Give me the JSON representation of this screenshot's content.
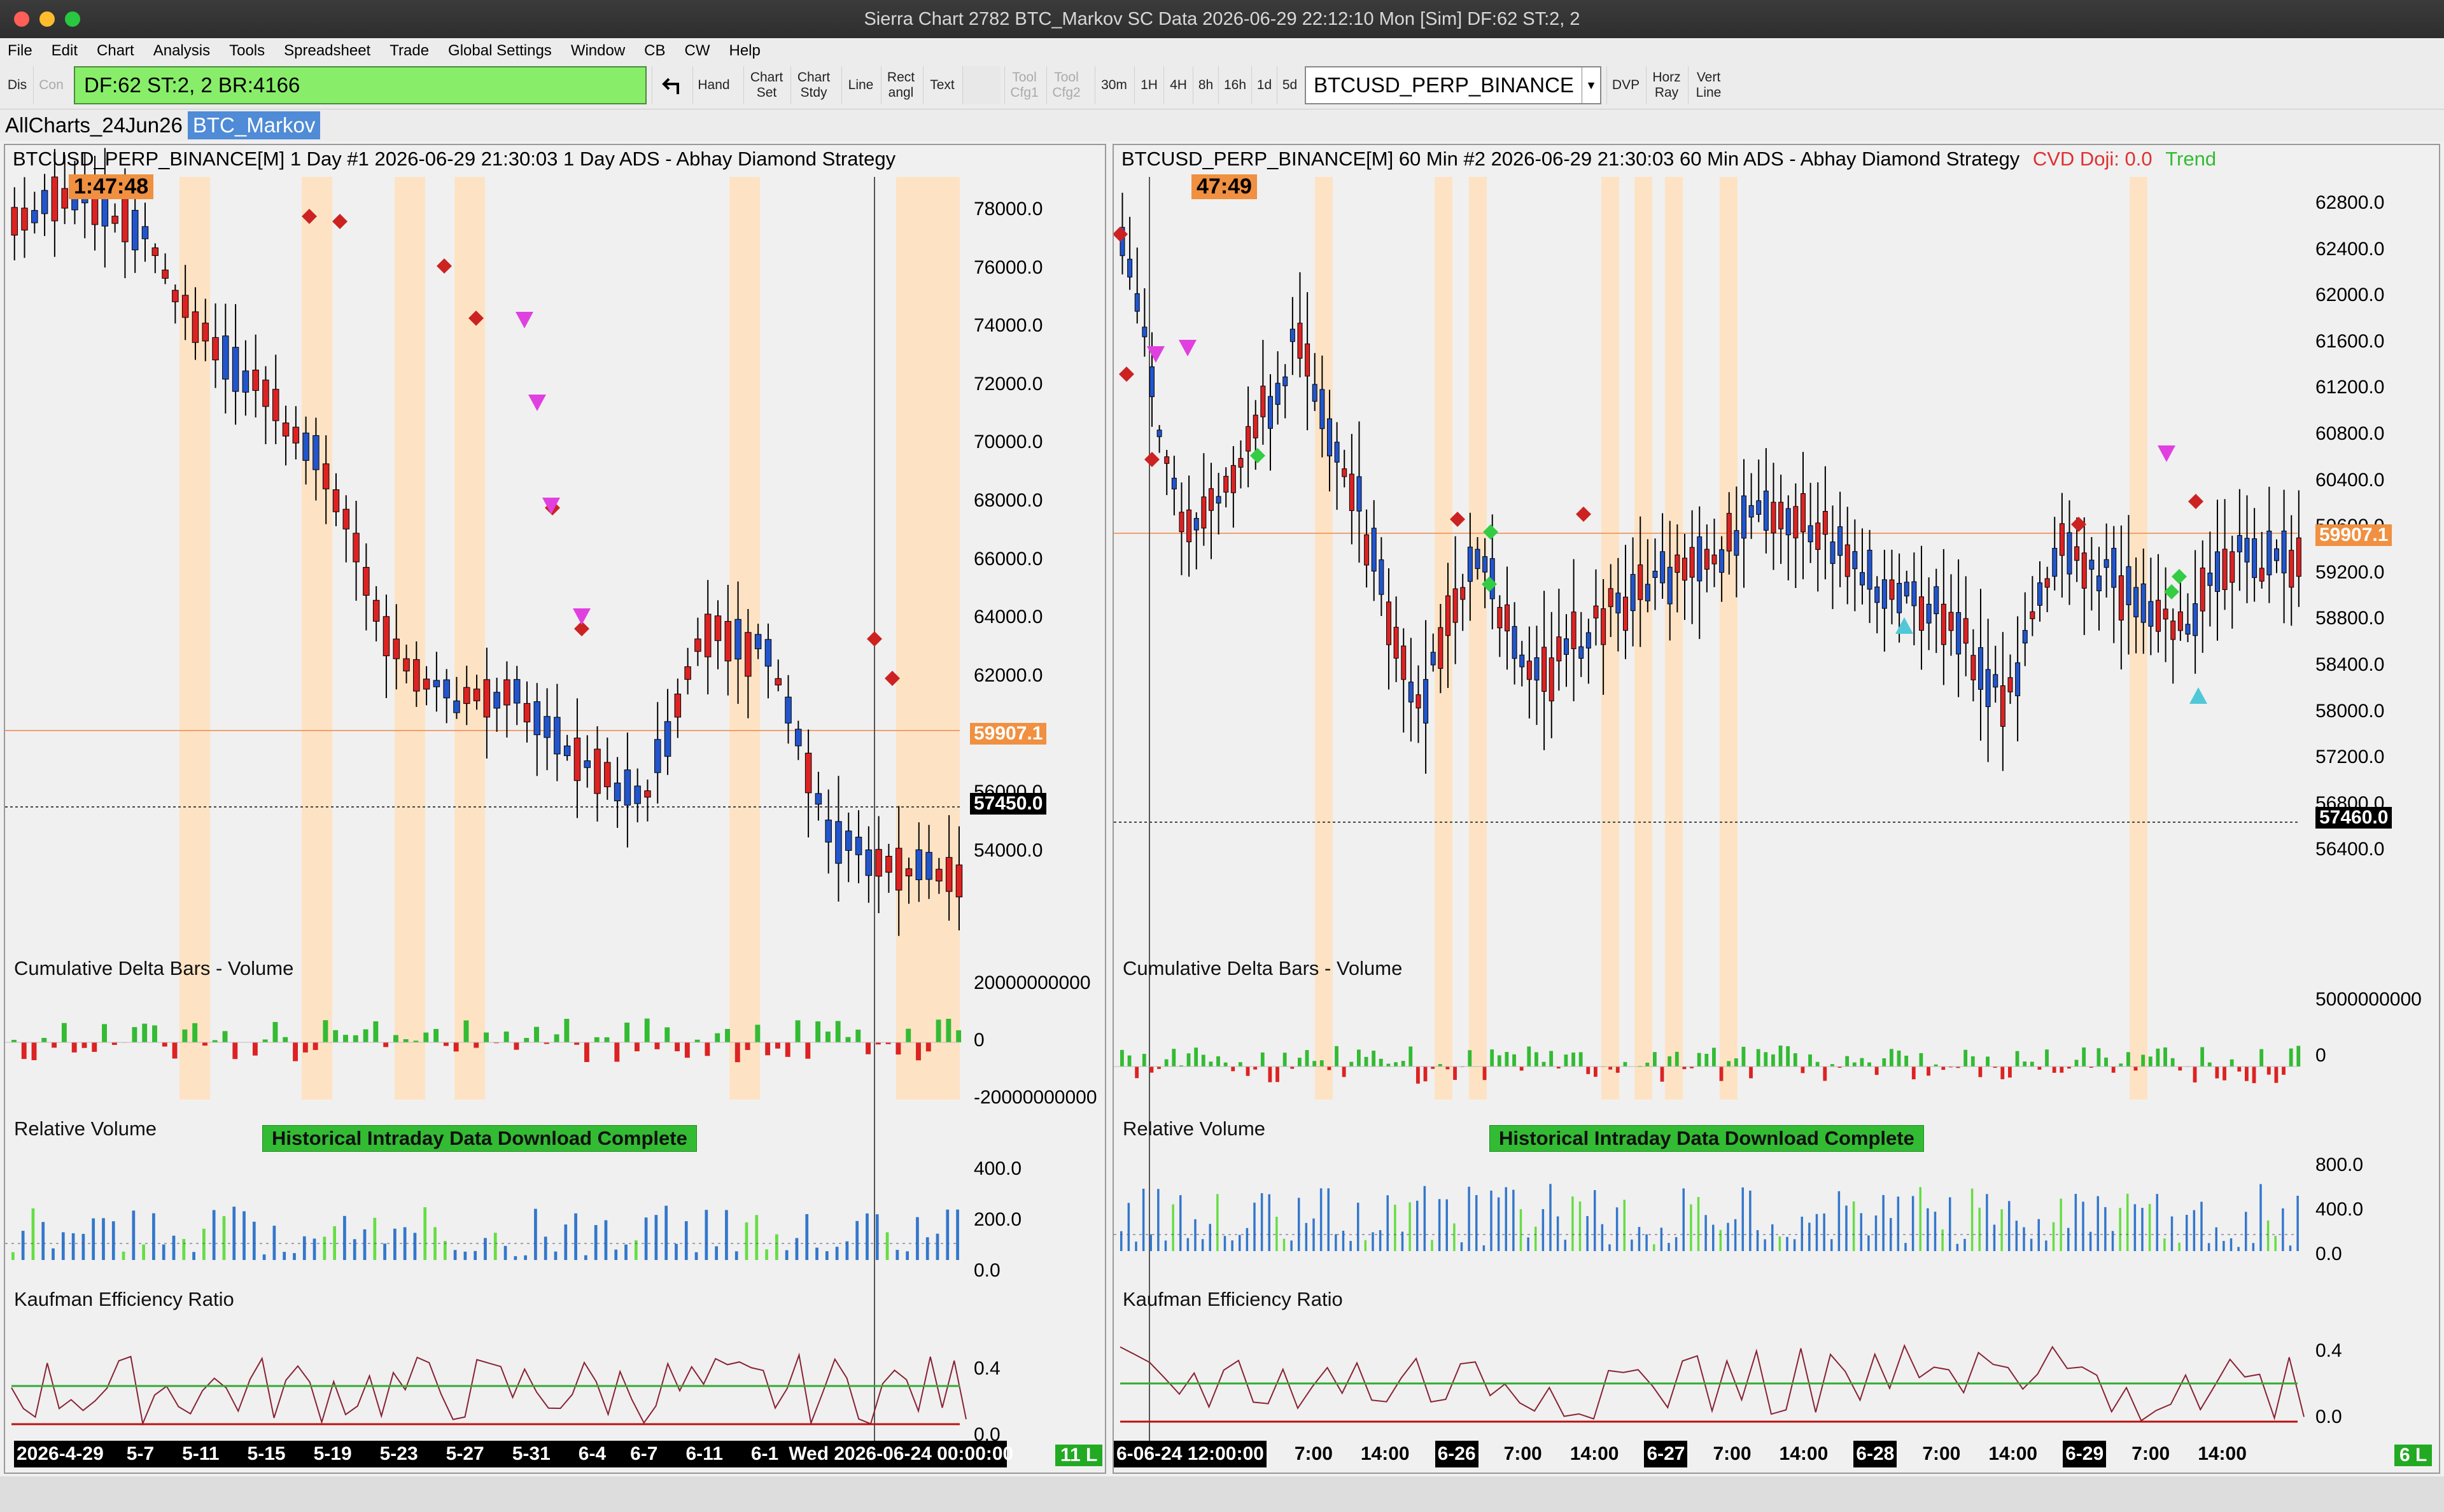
{
  "window": {
    "title": "Sierra Chart 2782 BTC_Markov SC Data 2026-06-29  22:12:10 Mon [Sim] DF:62  ST:2, 2"
  },
  "menu": [
    "File",
    "Edit",
    "Chart",
    "Analysis",
    "Tools",
    "Spreadsheet",
    "Trade",
    "Global Settings",
    "Window",
    "CB",
    "CW",
    "Help"
  ],
  "toolbar": {
    "dis": "Dis",
    "con": "Con",
    "status": "DF:62  ST:2, 2  BR:4166",
    "hand": "Hand",
    "chart_set": [
      "Chart",
      "Set"
    ],
    "chart_stdy": [
      "Chart",
      "Stdy"
    ],
    "line": "Line",
    "rect": [
      "Rect",
      "angl"
    ],
    "text": "Text",
    "tool1": [
      "Tool",
      "Cfg1"
    ],
    "tool2": [
      "Tool",
      "Cfg2"
    ],
    "tf": [
      "30m",
      "1H",
      "4H",
      "8h",
      "16h",
      "1d",
      "5d"
    ],
    "symbol": "BTCUSD_PERP_BINANCE",
    "dvp": "DVP",
    "horz": [
      "Horz",
      "Ray"
    ],
    "vert": [
      "Vert",
      "Line"
    ]
  },
  "tabs": [
    "AllCharts_24Jun26",
    "BTC_Markov"
  ],
  "colors": {
    "bull": "#2255cc",
    "bear": "#dd2222",
    "session": "#fde3c4",
    "green": "#33bb33",
    "orange": "#f09040"
  },
  "left": {
    "header": "BTCUSD_PERP_BINANCE[M]  1 Day  #1 2026-06-29 21:30:03 1 Day  ADS - Abhay Diamond Strategy",
    "timer": "1:47:48",
    "price_ticks": [
      "78000.0",
      "76000.0",
      "74000.0",
      "72000.0",
      "70000.0",
      "68000.0",
      "66000.0",
      "64000.0",
      "62000.0",
      "58000.0",
      "56000.0",
      "54000.0"
    ],
    "last_price": "59907.1",
    "cursor_price": "57450.0",
    "panel_cd": "Cumulative Delta Bars - Volume",
    "cd_ticks": [
      "20000000000",
      "0",
      "-20000000000"
    ],
    "panel_rv": "Relative Volume",
    "rv_ticks": [
      "400.0",
      "200.0",
      "0.0"
    ],
    "panel_ker": "Kaufman Efficiency Ratio",
    "ker_ticks": [
      "0.4",
      "0.0"
    ],
    "banner": "Historical Intraday Data Download Complete",
    "xlabels": [
      "2026-4-29",
      "5-7",
      "5-11",
      "5-15",
      "5-19",
      "5-23",
      "5-27",
      "5-31",
      "6-4",
      "6-7",
      "6-11",
      "6-1",
      "Wed 2026-06-24  00:00:00"
    ],
    "count": "11 L"
  },
  "right": {
    "header": "BTCUSD_PERP_BINANCE[M]  60 Min  #2 2026-06-29 21:30:03 60 Min  ADS - Abhay Diamond Strategy",
    "cvd": "CVD Doji: 0.0",
    "trend": "Trend",
    "timer": "47:49",
    "price_ticks": [
      "62800.0",
      "62400.0",
      "62000.0",
      "61600.0",
      "61200.0",
      "60800.0",
      "60400.0",
      "59600.0",
      "59200.0",
      "58800.0",
      "58400.0",
      "58000.0",
      "57200.0",
      "56800.0",
      "56400.0"
    ],
    "last_price": "59907.1",
    "cursor_price": "57460.0",
    "panel_cd": "Cumulative Delta Bars - Volume",
    "cd_ticks": [
      "5000000000",
      "0"
    ],
    "panel_rv": "Relative Volume",
    "rv_ticks": [
      "800.0",
      "400.0",
      "0.0"
    ],
    "panel_ker": "Kaufman Efficiency Ratio",
    "ker_ticks": [
      "0.4",
      "0.0"
    ],
    "banner": "Historical Intraday Data Download Complete",
    "xlabels": [
      "6-06-24  12:00:00",
      "7:00",
      "14:00",
      "6-26",
      "7:00",
      "14:00",
      "6-27",
      "7:00",
      "14:00",
      "6-28",
      "7:00",
      "14:00",
      "6-29",
      "7:00",
      "14:00"
    ],
    "count": "6 L"
  }
}
